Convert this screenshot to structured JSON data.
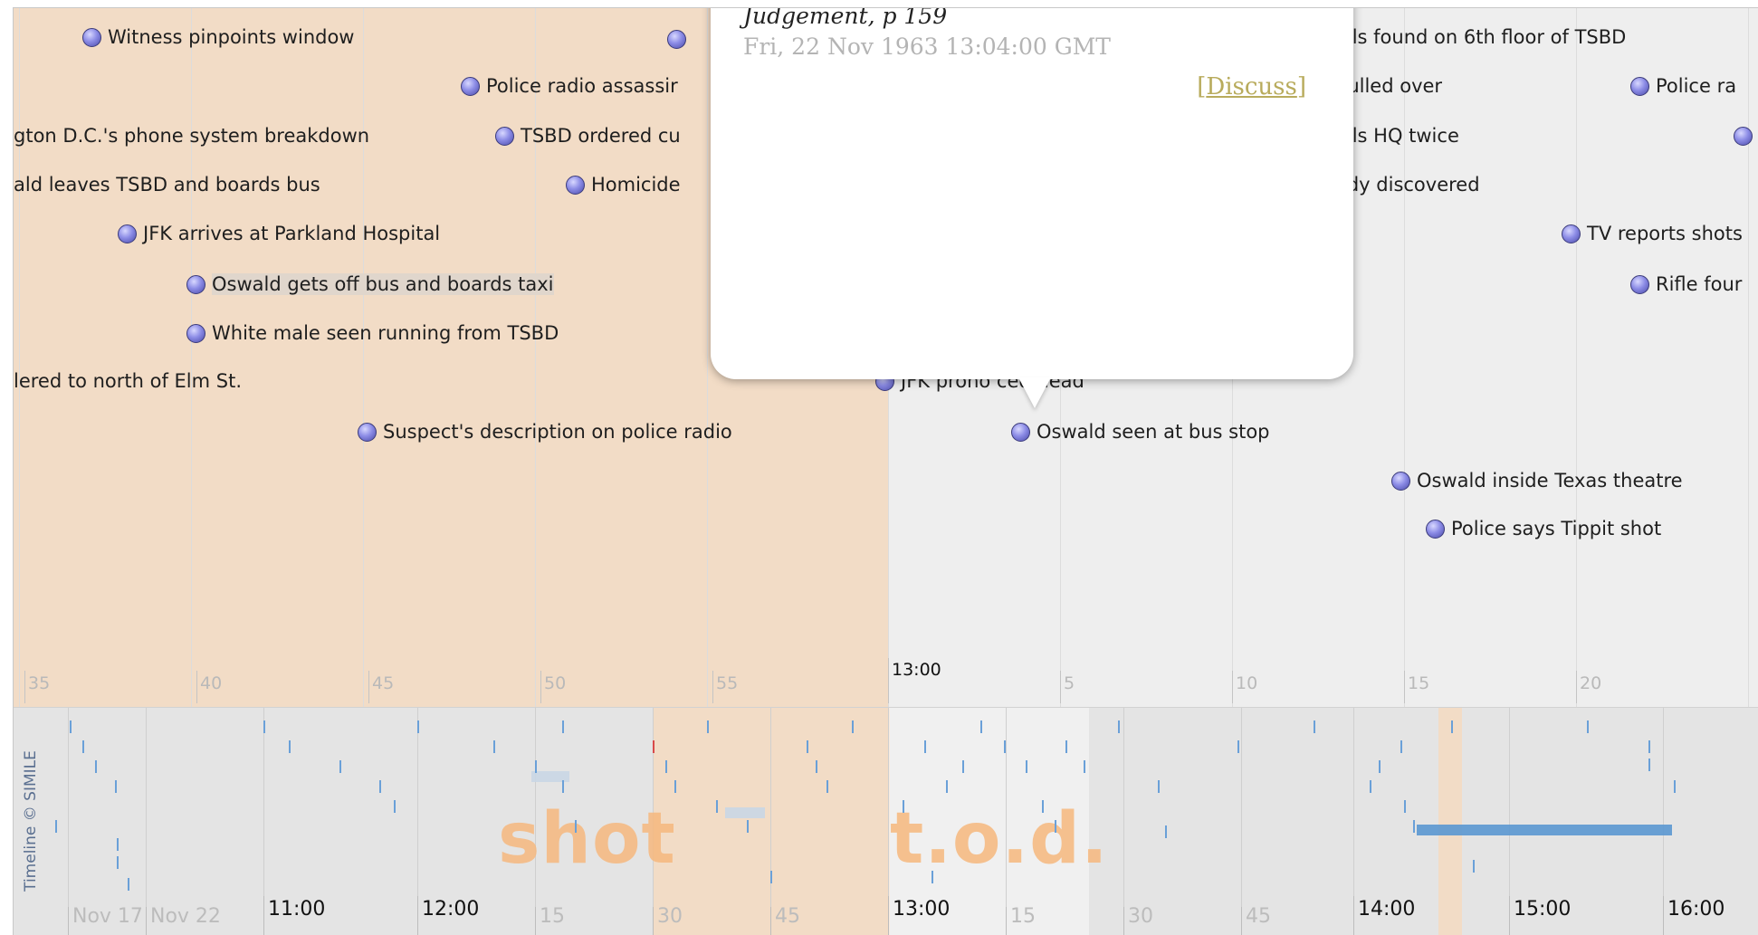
{
  "events": [
    {
      "label": "Witness pinpoints window"
    },
    {
      "label": ""
    },
    {
      "label": "Police radio assassir"
    },
    {
      "label": "gton D.C.'s phone system breakdown"
    },
    {
      "label": "TSBD ordered cu"
    },
    {
      "label": "ald leaves TSBD and boards bus"
    },
    {
      "label": "Homicide"
    },
    {
      "label": "JFK arrives at Parkland Hospital"
    },
    {
      "label": "Oswald gets off bus and boards taxi"
    },
    {
      "label": "White male seen running from TSBD"
    },
    {
      "label": "lered to north of Elm St."
    },
    {
      "label": "Suspect's description on police radio"
    },
    {
      "label": "JFK prono    ced dead"
    },
    {
      "label": "Oswald seen at bus stop"
    },
    {
      "label": "Oswald inside Texas theatre"
    },
    {
      "label": "Police says Tippit shot"
    },
    {
      "label": "alls found on 6th floor of TSBD"
    },
    {
      "label": "pulled over"
    },
    {
      "label": "Police ra"
    },
    {
      "label": "alls HQ twice"
    },
    {
      "label": ""
    },
    {
      "label": "ody discovered"
    },
    {
      "label": "TV reports shots"
    },
    {
      "label": "Rifle four"
    }
  ],
  "popup": {
    "source": "Judgement, p 159",
    "date": "Fri, 22 Nov 1963 13:04:00 GMT",
    "discuss": "Discuss"
  },
  "main_ticks": [
    "35",
    "40",
    "45",
    "50",
    "55",
    "13:00",
    "5",
    "10",
    "15",
    "20"
  ],
  "overview": {
    "credit": "Timeline © SIMILE",
    "labels": [
      "shot",
      "t.o.d."
    ],
    "ticks": [
      "Nov 17",
      "Nov 22",
      "11:00",
      "12:00",
      "15",
      "30",
      "45",
      "13:00",
      "15",
      "30",
      "45",
      "14:00",
      "15:00",
      "16:00"
    ]
  },
  "colors": {
    "highlight": "#f2dcc6",
    "band_bg": "#eeeeee",
    "event_dot": "#8c8ce6",
    "overview_mark": "#6aa0d8",
    "overview_label": "#f6b87e",
    "discuss_link": "#b8ab5c"
  }
}
